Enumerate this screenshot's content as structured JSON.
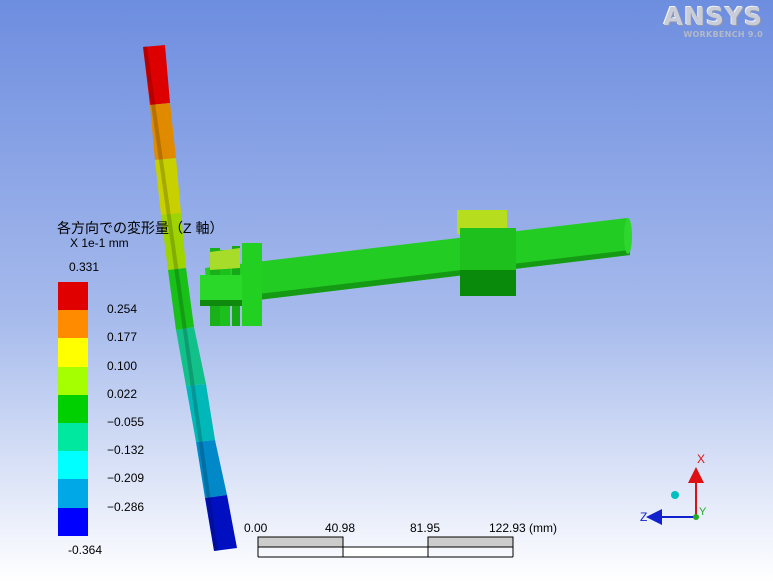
{
  "logo": {
    "brand": "ANSYS",
    "product": "WORKBENCH 9.0"
  },
  "legend": {
    "title": "各方向での変形量（Z 軸）",
    "unit": "X 1e-1 mm",
    "max": "0.331",
    "min": "-0.364",
    "bands": [
      {
        "color": "#e00000",
        "label": "0.254"
      },
      {
        "color": "#ff8c00",
        "label": "0.177"
      },
      {
        "color": "#ffff00",
        "label": "0.100"
      },
      {
        "color": "#a6ff00",
        "label": "0.022"
      },
      {
        "color": "#00d000",
        "label": "−0.055"
      },
      {
        "color": "#00e8a0",
        "label": "−0.132"
      },
      {
        "color": "#00ffff",
        "label": "−0.209"
      },
      {
        "color": "#00a8e8",
        "label": "−0.286"
      },
      {
        "color": "#0000ff",
        "label": ""
      }
    ]
  },
  "scale_bar": {
    "ticks": [
      "0.00",
      "40.98",
      "81.95",
      "122.93 (mm)"
    ]
  },
  "triad": {
    "x": "X",
    "y": "Y",
    "z": "Z"
  }
}
